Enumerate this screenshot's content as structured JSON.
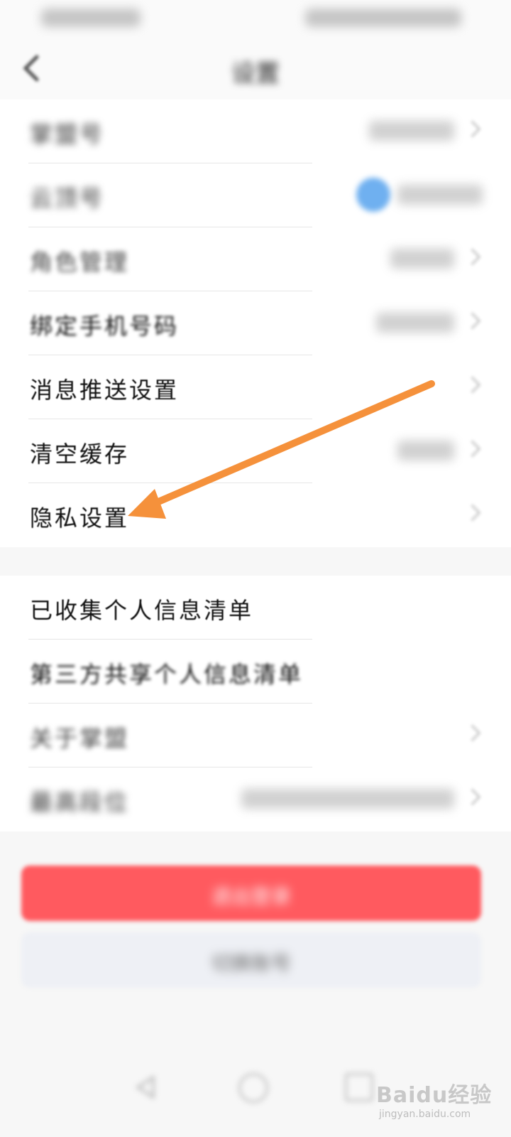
{
  "status_bar": {
    "left": "",
    "right": ""
  },
  "header": {
    "title": "设置",
    "back_icon": "chevron-left-icon"
  },
  "settings_group_1": [
    {
      "label": "掌盟号",
      "value": ""
    },
    {
      "label": "云顶号",
      "value": ""
    },
    {
      "label": "角色管理",
      "value": ""
    },
    {
      "label": "绑定手机号码",
      "value": ""
    },
    {
      "label": "消息推送设置",
      "value": ""
    },
    {
      "label": "清空缓存",
      "value": ""
    },
    {
      "label": "隐私设置",
      "value": ""
    }
  ],
  "settings_group_2": [
    {
      "label": "已收集个人信息清单"
    },
    {
      "label": "第三方共享个人信息清单"
    },
    {
      "label": "关于掌盟"
    },
    {
      "label": "最高段位",
      "value": ""
    }
  ],
  "buttons": {
    "logout": "退出登录",
    "switch_account": "切换账号"
  },
  "annotation": {
    "color": "#f5913b",
    "points_to": "隐私设置"
  },
  "nav_icons": [
    "back-nav-icon",
    "home-nav-icon",
    "recents-nav-icon"
  ],
  "watermark": {
    "brand": "Baidu经验",
    "url": "jingyan.baidu.com"
  },
  "colors": {
    "logout_bg": "#ff5a5f",
    "switch_bg": "#eef0f5",
    "arrow": "#f5913b"
  }
}
